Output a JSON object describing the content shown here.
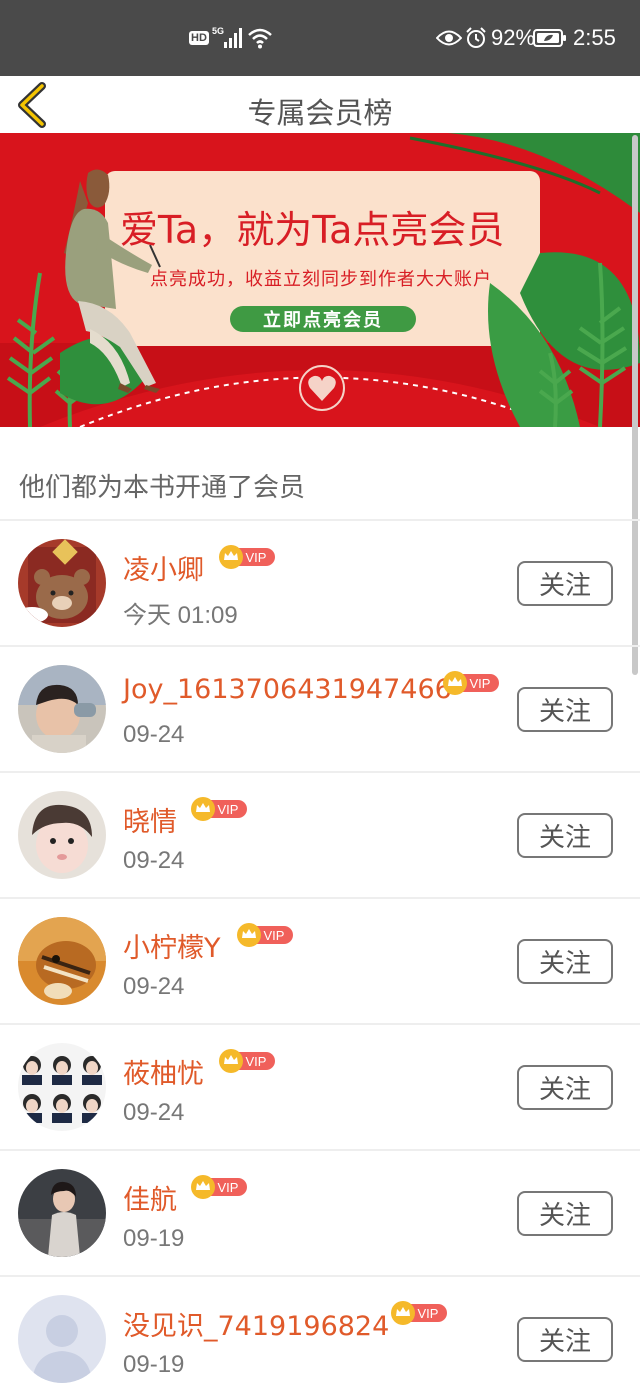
{
  "status_bar": {
    "hd": "HD",
    "network": "5G",
    "battery": "92%",
    "time": "2:55",
    "icons": [
      "signal-icon",
      "wifi-icon",
      "eye-icon",
      "alarm-icon",
      "battery-icon"
    ]
  },
  "header": {
    "title": "专属会员榜",
    "back_icon": "chevron-left-icon"
  },
  "banner": {
    "title": "爱Ta，就为Ta点亮会员",
    "subtitle": "点亮成功，收益立刻同步到作者大大账户",
    "button": "立即点亮会员"
  },
  "section": {
    "title": "他们都为本书开通了会员"
  },
  "vip_label": "VIP",
  "colors": {
    "accent": "#e05a2a",
    "banner_red": "#d81e25",
    "banner_green": "#3f9a43",
    "vip_pink": "#f0605a",
    "crown_gold": "#f5b92a"
  },
  "members": [
    {
      "name": "凌小卿",
      "date": "今天 01:09",
      "follow": "关注"
    },
    {
      "name": "Joy_1613706431947466",
      "date": "09-24",
      "follow": "关注"
    },
    {
      "name": "晓情",
      "date": "09-24",
      "follow": "关注"
    },
    {
      "name": "小柠檬Y",
      "date": "09-24",
      "follow": "关注"
    },
    {
      "name": "莜柚忧",
      "date": "09-24",
      "follow": "关注"
    },
    {
      "name": "佳航",
      "date": "09-19",
      "follow": "关注"
    },
    {
      "name": "没见识_7419196824",
      "date": "09-19",
      "follow": "关注"
    }
  ]
}
